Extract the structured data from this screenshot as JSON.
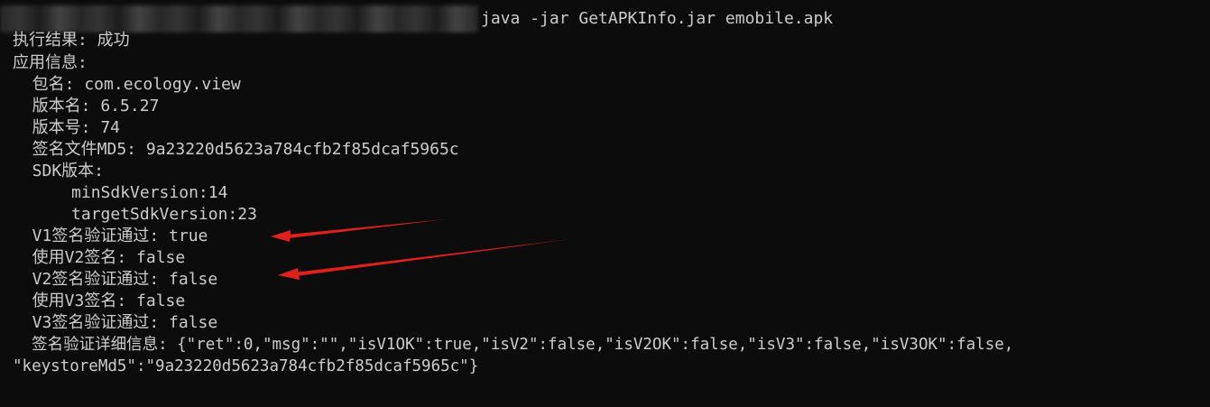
{
  "prompt": {
    "command": "java -jar GetAPKInfo.jar emobile.apk"
  },
  "output": {
    "status_line": "执行结果: 成功",
    "app_info_header": "应用信息:",
    "package": "  包名: com.ecology.view",
    "version_name": "  版本名: 6.5.27",
    "version_code": "  版本号: 74",
    "sign_md5": "  签名文件MD5: 9a23220d5623a784cfb2f85dcaf5965c",
    "sdk_header": "  SDK版本:",
    "min_sdk": "      minSdkVersion:14",
    "target_sdk": "      targetSdkVersion:23",
    "v1_verified": "  V1签名验证通过: true",
    "use_v2": "  使用V2签名: false",
    "v2_verified": "  V2签名验证通过: false",
    "use_v3": "  使用V3签名: false",
    "v3_verified": "  V3签名验证通过: false",
    "detail_line1": "  签名验证详细信息: {\"ret\":0,\"msg\":\"\",\"isV1OK\":true,\"isV2\":false,\"isV2OK\":false,\"isV3\":false,\"isV3OK\":false,",
    "detail_line2": "\"keystoreMd5\":\"9a23220d5623a784cfb2f85dcaf5965c\"}"
  },
  "colors": {
    "background": "#0c0c0c",
    "text": "#cccccc",
    "annotation_arrow": "#e0201b"
  }
}
